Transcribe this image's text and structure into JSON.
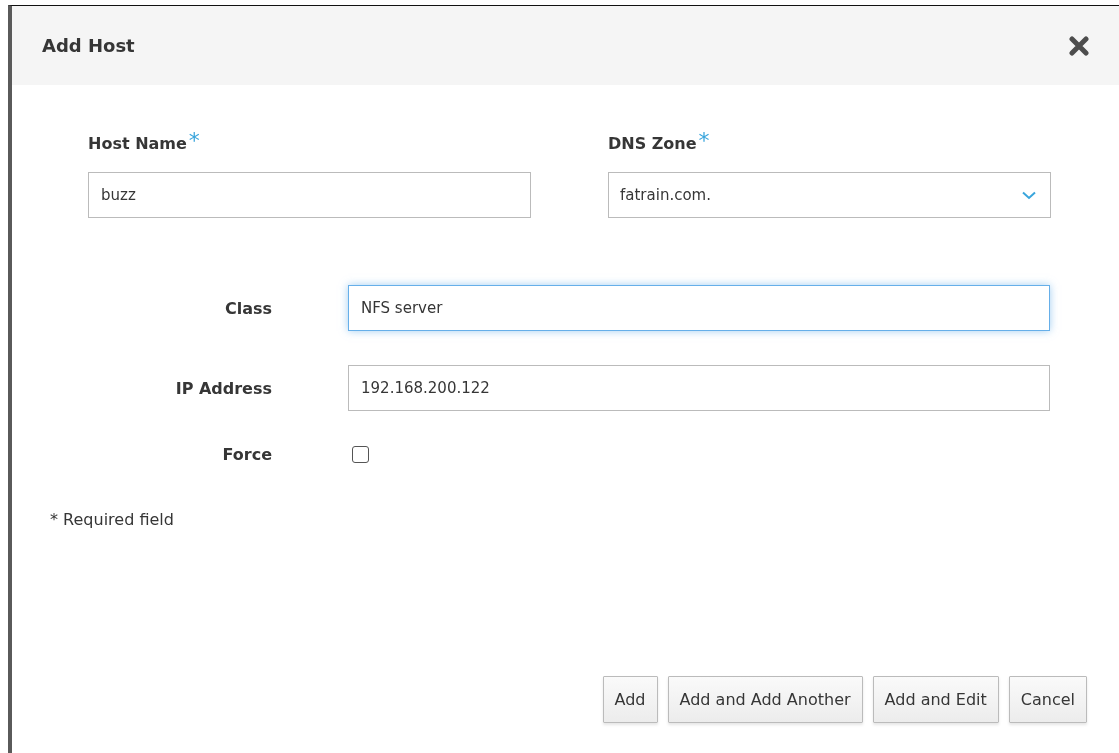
{
  "dialog": {
    "title": "Add Host"
  },
  "top_fields": [
    {
      "kind": "text",
      "label": "Host Name",
      "required_mark": "*",
      "value": "buzz"
    },
    {
      "kind": "select",
      "label": "DNS Zone",
      "required_mark": "*",
      "value": "fatrain.com."
    }
  ],
  "fields": [
    {
      "kind": "text",
      "label": "Class",
      "value": "NFS server",
      "focused": true
    },
    {
      "kind": "text",
      "label": "IP Address",
      "value": "192.168.200.122",
      "focused": false
    },
    {
      "kind": "checkbox",
      "label": "Force",
      "checked": false
    }
  ],
  "required_note": "* Required field",
  "buttons": [
    "Add",
    "Add and Add Another",
    "Add and Edit",
    "Cancel"
  ]
}
